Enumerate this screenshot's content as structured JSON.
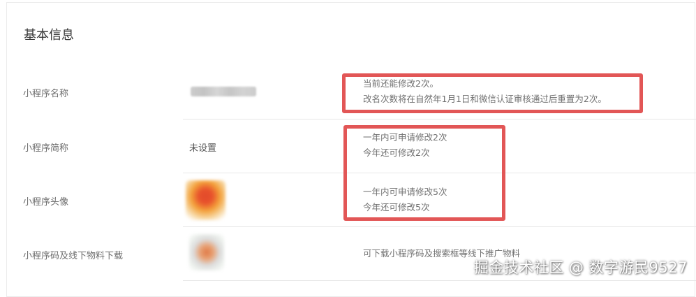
{
  "section": {
    "title": "基本信息"
  },
  "rows": [
    {
      "label": "小程序名称",
      "notes": [
        "当前还能修改2次。",
        "改名次数将在自然年1月1日和微信认证审核通过后重置为2次。"
      ]
    },
    {
      "label": "小程序简称",
      "value": "未设置",
      "notes": [
        "一年内可申请修改2次",
        "今年还可修改2次"
      ]
    },
    {
      "label": "小程序头像",
      "notes": [
        "一年内可申请修改5次",
        "今年还可修改5次"
      ]
    },
    {
      "label": "小程序码及线下物料下载",
      "note": "可下载小程序码及搜索框等线下推广物料"
    }
  ],
  "colors": {
    "highlight": "#e25656",
    "divider": "#e7e7e7",
    "label_text": "#6b6b6b"
  },
  "watermark": "掘金技术社区 @ 数字游民9527"
}
